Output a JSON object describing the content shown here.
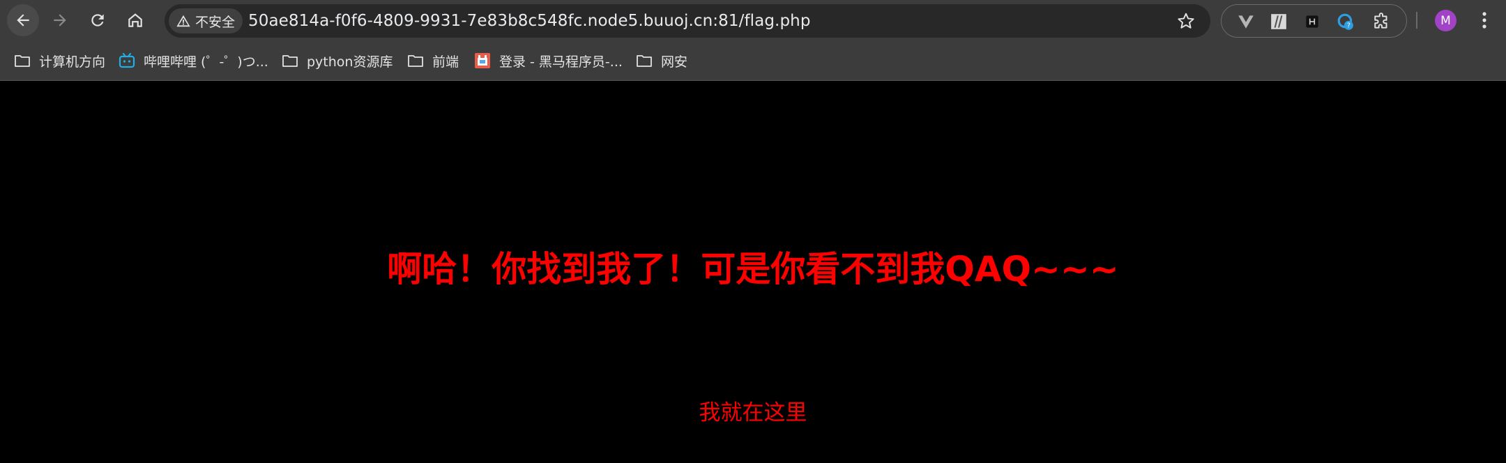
{
  "browser": {
    "security_label": "不安全",
    "url": "50ae814a-f0f6-4809-9931-7e83b8c548fc.node5.buuoj.cn:81/flag.php",
    "avatar_letter": "M",
    "extensions": [
      "vue-devtools-icon",
      "extension-icon-2",
      "extension-icon-3",
      "extension-icon-4",
      "extensions-puzzle-icon"
    ]
  },
  "bookmarks": [
    {
      "label": "计算机方向",
      "icon": "folder-icon"
    },
    {
      "label": "哔哩哔哩 (゜-゜)つ...",
      "icon": "bilibili-icon"
    },
    {
      "label": "python资源库",
      "icon": "folder-icon"
    },
    {
      "label": "前端",
      "icon": "folder-icon"
    },
    {
      "label": "登录 - 黑马程序员-...",
      "icon": "site-favicon-icon"
    },
    {
      "label": "网安",
      "icon": "folder-icon"
    }
  ],
  "page": {
    "headline": "啊哈！你找到我了！可是你看不到我QAQ~~~",
    "link_text": "我就在这里"
  },
  "colors": {
    "page_text": "#ff0000",
    "page_background": "#000000",
    "chrome": "#3c3c3c"
  }
}
